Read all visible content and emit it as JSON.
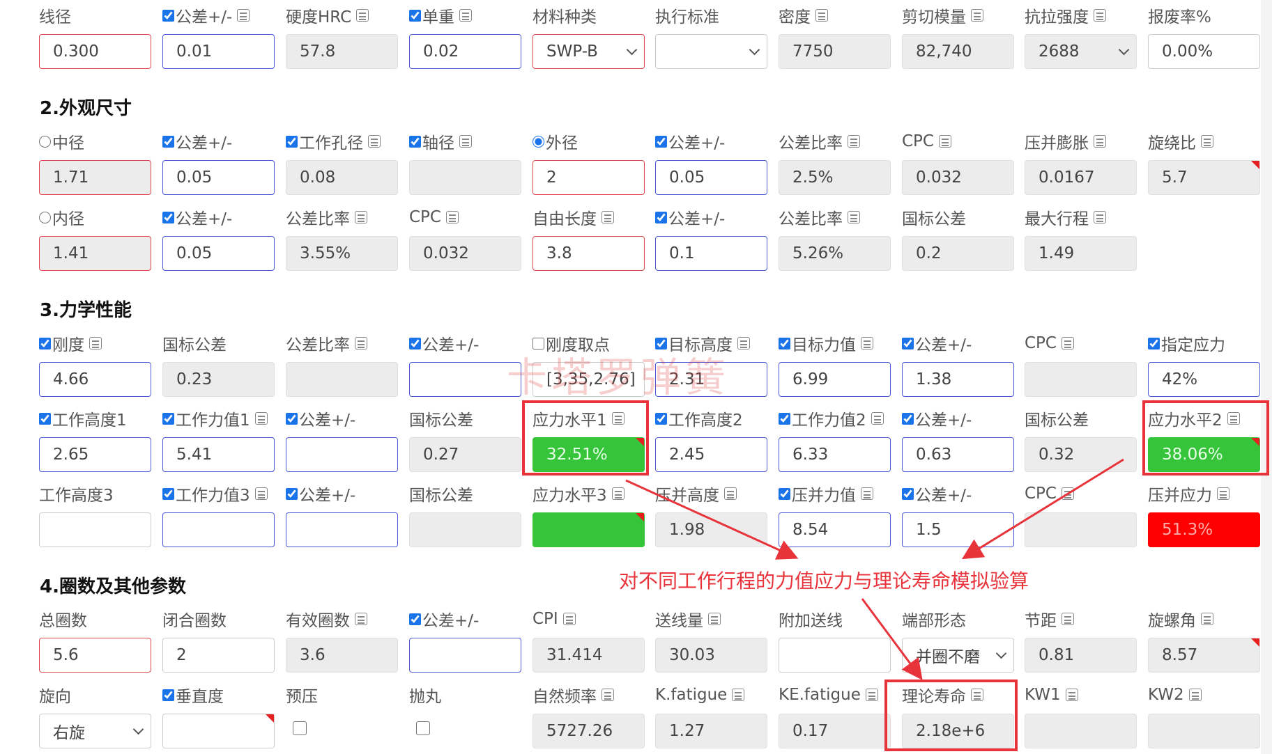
{
  "row0": [
    {
      "label": "线径",
      "check": false,
      "calc": false,
      "value": "0.300",
      "style": "red"
    },
    {
      "label": "公差+/-",
      "check": true,
      "calc": true,
      "value": "0.01",
      "style": "blue"
    },
    {
      "label": "硬度HRC",
      "check": false,
      "calc": true,
      "value": "57.8",
      "style": "ro"
    },
    {
      "label": "单重",
      "check": true,
      "calc": true,
      "value": "0.02",
      "style": "blue"
    },
    {
      "label": "材料种类",
      "check": false,
      "calc": false,
      "value": "SWP-B",
      "style": "red",
      "select": true
    },
    {
      "label": "执行标准",
      "check": false,
      "calc": false,
      "value": "",
      "style": "plain",
      "select": true
    },
    {
      "label": "密度",
      "check": false,
      "calc": true,
      "value": "7750",
      "style": "ro"
    },
    {
      "label": "剪切模量",
      "check": false,
      "calc": true,
      "value": "82,740",
      "style": "ro"
    },
    {
      "label": "抗拉强度",
      "check": false,
      "calc": true,
      "value": "2688",
      "style": "ro",
      "select": true
    },
    {
      "label": "报废率%",
      "check": false,
      "calc": false,
      "value": "0.00%",
      "style": "plain"
    }
  ],
  "section2": "2.外观尺寸",
  "row1": [
    {
      "label": "中径",
      "radio": "off",
      "value": "1.71",
      "style": "roRed"
    },
    {
      "label": "公差+/-",
      "check": true,
      "value": "0.05",
      "style": "blue"
    },
    {
      "label": "工作孔径",
      "check": true,
      "calc": true,
      "value": "0.08",
      "style": "ro"
    },
    {
      "label": "轴径",
      "check": true,
      "calc": true,
      "value": "",
      "style": "ro"
    },
    {
      "label": "外径",
      "radio": "on",
      "value": "2",
      "style": "red"
    },
    {
      "label": "公差+/-",
      "check": true,
      "value": "0.05",
      "style": "blue"
    },
    {
      "label": "公差比率",
      "calc": true,
      "value": "2.5%",
      "style": "ro"
    },
    {
      "label": "CPC",
      "calc": true,
      "value": "0.032",
      "style": "ro"
    },
    {
      "label": "压并膨胀",
      "calc": true,
      "value": "0.0167",
      "style": "ro"
    },
    {
      "label": "旋绕比",
      "calc": true,
      "value": "5.7",
      "style": "ro",
      "flag": true
    }
  ],
  "row2": [
    {
      "label": "内径",
      "radio": "off",
      "value": "1.41",
      "style": "roRed"
    },
    {
      "label": "公差+/-",
      "check": true,
      "value": "0.05",
      "style": "blue"
    },
    {
      "label": "公差比率",
      "calc": true,
      "value": "3.55%",
      "style": "ro"
    },
    {
      "label": "CPC",
      "calc": true,
      "value": "0.032",
      "style": "ro"
    },
    {
      "label": "自由长度",
      "calc": true,
      "value": "3.8",
      "style": "red"
    },
    {
      "label": "公差+/-",
      "check": true,
      "value": "0.1",
      "style": "blue"
    },
    {
      "label": "公差比率",
      "calc": true,
      "value": "5.26%",
      "style": "ro"
    },
    {
      "label": "国标公差",
      "value": "0.2",
      "style": "ro"
    },
    {
      "label": "最大行程",
      "calc": true,
      "value": "1.49",
      "style": "ro"
    }
  ],
  "section3": "3.力学性能",
  "row3": [
    {
      "label": "刚度",
      "check": true,
      "calc": true,
      "value": "4.66",
      "style": "blue"
    },
    {
      "label": "国标公差",
      "value": "0.23",
      "style": "ro"
    },
    {
      "label": "公差比率",
      "calc": true,
      "value": "",
      "style": "ro"
    },
    {
      "label": "公差+/-",
      "check": true,
      "value": "",
      "style": "blue"
    },
    {
      "label": "刚度取点",
      "check": false,
      "uncheck": true,
      "value": "[3,35,2.76]",
      "style": "plain"
    },
    {
      "label": "目标高度",
      "check": true,
      "calc": true,
      "value": "2.31",
      "style": "blue"
    },
    {
      "label": "目标力值",
      "check": true,
      "calc": true,
      "value": "6.99",
      "style": "blue"
    },
    {
      "label": "公差+/-",
      "check": true,
      "value": "1.38",
      "style": "blue"
    },
    {
      "label": "CPC",
      "calc": true,
      "value": "",
      "style": "ro"
    },
    {
      "label": "指定应力",
      "check": true,
      "value": "42%",
      "style": "blue"
    }
  ],
  "row4": [
    {
      "label": "工作高度1",
      "check": true,
      "value": "2.65",
      "style": "blue"
    },
    {
      "label": "工作力值1",
      "check": true,
      "calc": true,
      "value": "5.41",
      "style": "blue"
    },
    {
      "label": "公差+/-",
      "check": true,
      "value": "",
      "style": "blue"
    },
    {
      "label": "国标公差",
      "value": "0.27",
      "style": "ro"
    },
    {
      "label": "应力水平1",
      "calc": true,
      "value": "32.51%",
      "style": "green",
      "flag": true
    },
    {
      "label": "工作高度2",
      "check": true,
      "value": "2.45",
      "style": "blue"
    },
    {
      "label": "工作力值2",
      "check": true,
      "calc": true,
      "value": "6.33",
      "style": "blue"
    },
    {
      "label": "公差+/-",
      "check": true,
      "value": "0.63",
      "style": "blue"
    },
    {
      "label": "国标公差",
      "value": "0.32",
      "style": "ro"
    },
    {
      "label": "应力水平2",
      "calc": true,
      "value": "38.06%",
      "style": "green",
      "flag": true
    }
  ],
  "row5": [
    {
      "label": "工作高度3",
      "value": "",
      "style": "plain"
    },
    {
      "label": "工作力值3",
      "check": true,
      "calc": true,
      "value": "",
      "style": "blue"
    },
    {
      "label": "公差+/-",
      "check": true,
      "value": "",
      "style": "blue"
    },
    {
      "label": "国标公差",
      "value": "",
      "style": "ro"
    },
    {
      "label": "应力水平3",
      "calc": true,
      "value": "",
      "style": "green",
      "flag": true
    },
    {
      "label": "压并高度",
      "calc": true,
      "value": "1.98",
      "style": "ro"
    },
    {
      "label": "压并力值",
      "check": true,
      "calc": true,
      "value": "8.54",
      "style": "blue"
    },
    {
      "label": "公差+/-",
      "check": true,
      "value": "1.5",
      "style": "blue"
    },
    {
      "label": "CPC",
      "calc": true,
      "value": "",
      "style": "ro"
    },
    {
      "label": "压并应力",
      "calc": true,
      "value": "51.3%",
      "style": "redfill"
    }
  ],
  "section4": "4.圈数及其他参数",
  "annotation": "对不同工作行程的力值应力与理论寿命模拟验算",
  "watermark": "卡塔罗弹簧",
  "row6": [
    {
      "label": "总圈数",
      "value": "5.6",
      "style": "red"
    },
    {
      "label": "闭合圈数",
      "value": "2",
      "style": "plain"
    },
    {
      "label": "有效圈数",
      "calc": true,
      "value": "3.6",
      "style": "ro"
    },
    {
      "label": "公差+/-",
      "check": true,
      "value": "",
      "style": "blue"
    },
    {
      "label": "CPI",
      "calc": true,
      "value": "31.414",
      "style": "ro"
    },
    {
      "label": "送线量",
      "calc": true,
      "value": "30.03",
      "style": "ro"
    },
    {
      "label": "附加送线",
      "value": "",
      "style": "plain"
    },
    {
      "label": "端部形态",
      "value": "并圈不磨",
      "style": "plain",
      "select": true
    },
    {
      "label": "节距",
      "calc": true,
      "value": "0.81",
      "style": "ro"
    },
    {
      "label": "旋螺角",
      "calc": true,
      "value": "8.57",
      "style": "ro",
      "flag": true
    }
  ],
  "row7": [
    {
      "label": "旋向",
      "value": "右旋",
      "style": "plain",
      "select": true
    },
    {
      "label": "垂直度",
      "check": true,
      "value": "",
      "style": "plain",
      "flag": true
    },
    {
      "label": "预压",
      "value": "",
      "style": "checkbox"
    },
    {
      "label": "抛丸",
      "value": "",
      "style": "checkbox"
    },
    {
      "label": "自然频率",
      "calc": true,
      "value": "5727.26",
      "style": "ro"
    },
    {
      "label": "K.fatigue",
      "calc": true,
      "value": "1.27",
      "style": "ro"
    },
    {
      "label": "KE.fatigue",
      "calc": true,
      "value": "0.17",
      "style": "ro"
    },
    {
      "label": "理论寿命",
      "calc": true,
      "value": "2.18e+6",
      "style": "ro"
    },
    {
      "label": "KW1",
      "calc": true,
      "value": "",
      "style": "ro"
    },
    {
      "label": "KW2",
      "calc": true,
      "value": "",
      "style": "ro"
    }
  ]
}
